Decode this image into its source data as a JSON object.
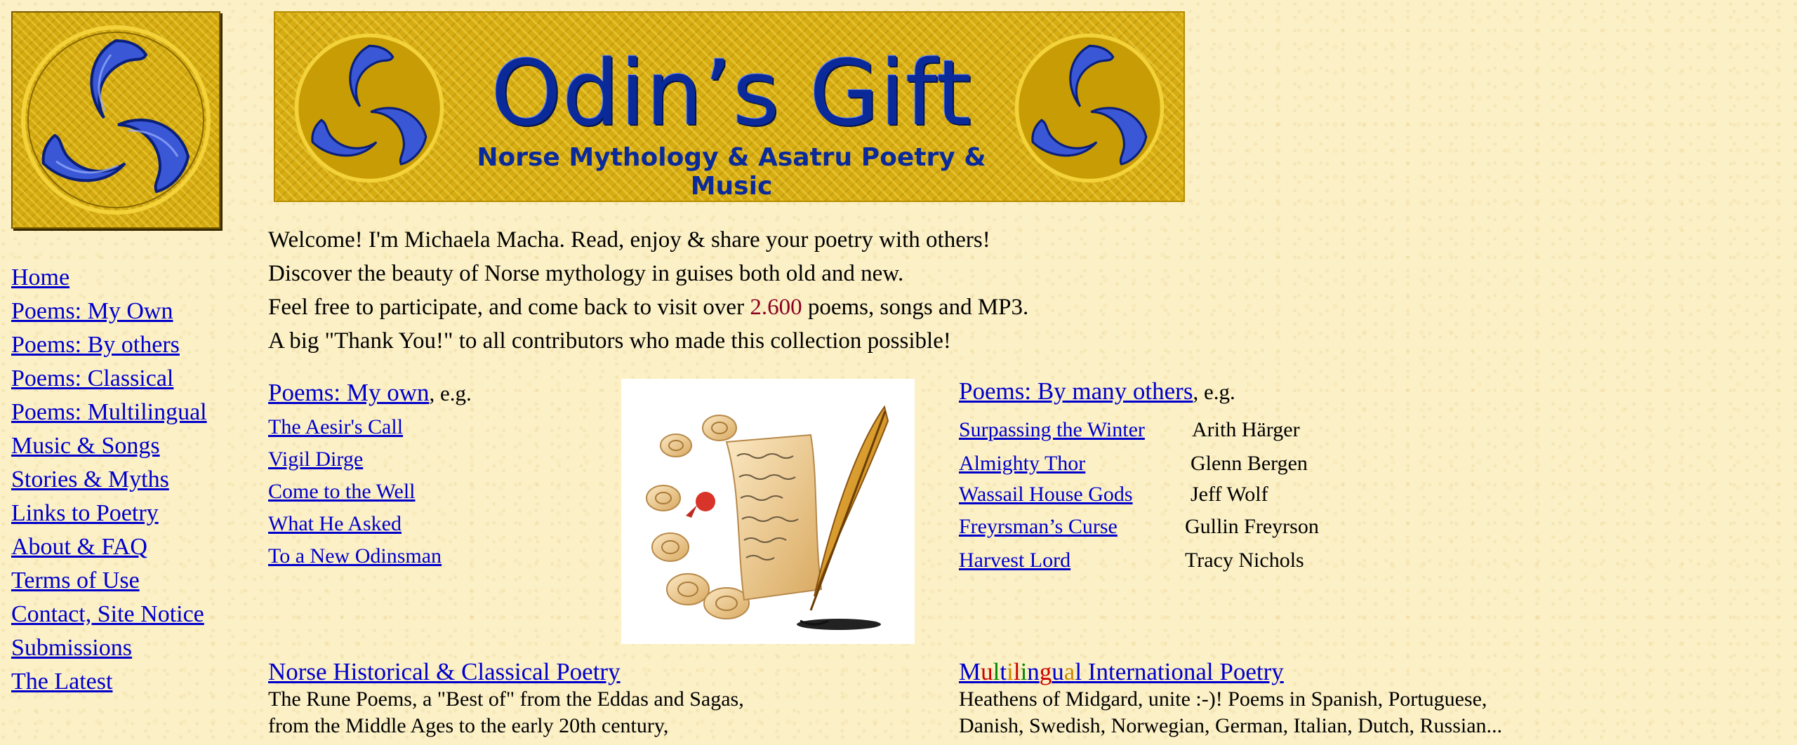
{
  "site": {
    "title": "Odin’s Gift",
    "subtitle": "Norse Mythology & Asatru Poetry & Music"
  },
  "colors": {
    "link": "#0000cc",
    "banner_gold": "#d6ac12",
    "banner_blue": "#0b2a9a",
    "count": "#8b0020"
  },
  "icons": {
    "logo": "triskele-horn-icon",
    "banner_left": "triskele-horn-icon",
    "banner_right": "triskele-horn-icon",
    "poetry_image": "scrolls-quill-image"
  },
  "nav": [
    {
      "label": "Home"
    },
    {
      "label": "Poems: My Own"
    },
    {
      "label": "Poems: By others"
    },
    {
      "label": "Poems: Classical"
    },
    {
      "label": "Poems: Multilingual"
    },
    {
      "label": "Music & Songs"
    },
    {
      "label": "Stories & Myths"
    },
    {
      "label": "Links to Poetry"
    },
    {
      "label": "About & FAQ"
    },
    {
      "label": "Terms of Use"
    },
    {
      "label": "Contact, Site Notice"
    },
    {
      "label": "Submissions"
    },
    {
      "label": "The Latest"
    }
  ],
  "welcome": {
    "line1": "Welcome! I'm Michaela Macha. Read, enjoy & share your poetry with others!",
    "line2": "Discover the beauty of Norse mythology in guises both old and new.",
    "line3_pre": "Feel free to participate, and come back to visit over ",
    "line3_count": "2.600",
    "line3_post": " poems, songs and MP3.",
    "line4": "A big \"Thank You!\" to all contributors who made this collection possible!"
  },
  "own_poems": {
    "heading": "Poems: My own",
    "eg": ", e.g.",
    "items": [
      {
        "title": "The Aesir's Call"
      },
      {
        "title": "Vigil Dirge"
      },
      {
        "title": "Come to the Well"
      },
      {
        "title": "What He Asked"
      },
      {
        "title": "To a New Odinsman"
      }
    ]
  },
  "others_poems": {
    "heading": "Poems: By many others",
    "eg": ", e.g.",
    "items": [
      {
        "title": "Surpassing the Winter",
        "author": "Arith Härger"
      },
      {
        "title": "Almighty Thor",
        "author": "Glenn Bergen"
      },
      {
        "title": "Wassail House Gods",
        "author": "Jeff Wolf"
      },
      {
        "title": "Freyrsman’s Curse",
        "author": "Gullin Freyrson"
      },
      {
        "title": "Harvest Lord",
        "author": "Tracy Nichols"
      }
    ]
  },
  "classical": {
    "heading": "Norse Historical & Classical Poetry",
    "desc1": "The Rune Poems, a \"Best of\" from the Eddas and  Sagas,",
    "desc2": "from the Middle Ages to the early 20th century,"
  },
  "multilingual": {
    "heading_letters": [
      "M",
      "u",
      "l",
      "t",
      "i",
      "l",
      "i",
      "n",
      "g",
      "u",
      "a",
      "l"
    ],
    "heading_colors": [
      "#0000cc",
      "#cc0000",
      "#008800",
      "#0000cc",
      "#cc8800",
      "#cc0000",
      "#008800",
      "#0000cc",
      "#cc0000",
      "#0000cc",
      "#cc8800",
      "#0000cc"
    ],
    "heading_rest": " International Poetry",
    "desc1": "Heathens of Midgard, unite :-)! Poems in Spanish, Portuguese,",
    "desc2": "Danish, Swedish, Norwegian, German, Italian, Dutch, Russian..."
  }
}
